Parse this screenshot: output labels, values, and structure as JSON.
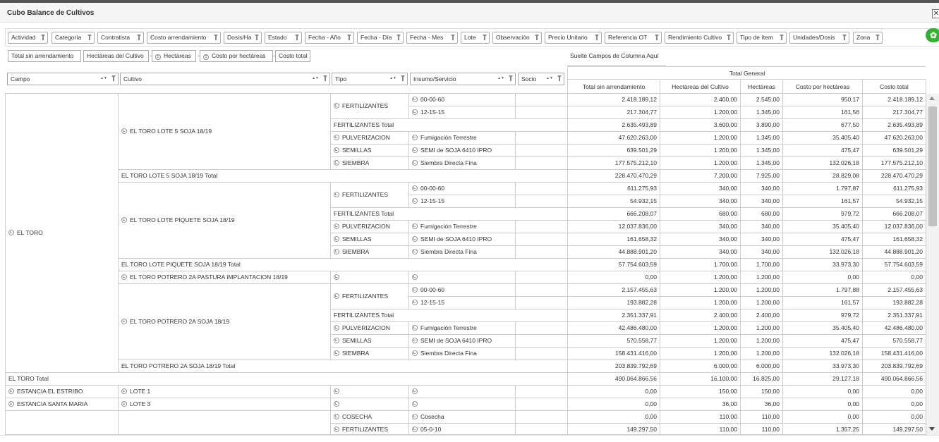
{
  "window": {
    "title": "Cubo Balance de Cultivos",
    "close_glyph": "✕"
  },
  "filter_fields": [
    "Actividad",
    "Categoría",
    "Contratista",
    "Costo arrendamiento",
    "Dosis/Ha",
    "Estado",
    "Fecha - Año",
    "Fecha - Día",
    "Fecha - Mes",
    "Lote",
    "Observación",
    "Precio Unitario",
    "Referencia OT",
    "Rendimiento Cultivo",
    "Tipo de ítem",
    "Unidades/Dosis",
    "Zona"
  ],
  "value_fields": [
    "Total sin arrendamiento",
    "Hectáreas del Cultivo",
    "Hectáreas",
    "Costo por hectáreas",
    "Costo total"
  ],
  "column_drop_hint": "Suelte Campos de Columna Aquí",
  "row_fields": [
    "Campo",
    "Cultivo",
    "Tipo",
    "Insumo/Servicio",
    "Socio"
  ],
  "total_general": "Total General",
  "measure_headers": [
    "Total sin arrendamiento",
    "Hectáreas del Cultivo",
    "Hectáreas",
    "Costo por hectáreas",
    "Costo total"
  ],
  "icons": {
    "filter": "filter-icon",
    "sort": "sort-icon",
    "expand": "expand-icon",
    "settings": "settings-icon"
  },
  "colors": {
    "accent_green": "#2db52d",
    "border": "#cccccc"
  },
  "campos": [
    {
      "label": "EL TORO",
      "expand": true
    },
    {
      "label": "EL TORO Total"
    },
    {
      "label": "ESTANCIA EL ESTRIBO",
      "expand": true
    },
    {
      "label": "ESTANCIA SANTA MARIA",
      "expand": true
    }
  ],
  "cultivos": [
    {
      "label": "EL TORO LOTE 5 SOJA 18/19",
      "expand": true
    },
    {
      "label": "EL TORO LOTE 5 SOJA 18/19 Total"
    },
    {
      "label": "EL TORO LOTE PIQUETE SOJA 18/19",
      "expand": true
    },
    {
      "label": "EL TORO LOTE PIQUETE SOJA 18/19 Total"
    },
    {
      "label": "EL TORO POTRERO 2A PASTURA IMPLANTACION 18/19",
      "expand": true
    },
    {
      "label": "EL TORO POTRERO 2A SOJA 18/19",
      "expand": true
    },
    {
      "label": "EL TORO POTRERO 2A SOJA 18/19 Total"
    },
    {
      "label": "LOTE 1",
      "expand": true
    },
    {
      "label": "LOTE 3",
      "expand": true
    }
  ],
  "tipos": [
    {
      "label": "FERTILIZANTES",
      "expand": true
    },
    {
      "label": "FERTILIZANTES Total"
    },
    {
      "label": "PULVERIZACION",
      "expand": true
    },
    {
      "label": "SEMILLAS",
      "expand": true
    },
    {
      "label": "SIEMBRA",
      "expand": true
    },
    {
      "label": "FERTILIZANTES",
      "expand": true
    },
    {
      "label": "FERTILIZANTES Total"
    },
    {
      "label": "PULVERIZACION",
      "expand": true
    },
    {
      "label": "SEMILLAS",
      "expand": true
    },
    {
      "label": "SIEMBRA",
      "expand": true
    },
    {
      "label": "",
      "expand": true
    },
    {
      "label": "FERTILIZANTES",
      "expand": true
    },
    {
      "label": "FERTILIZANTES Total"
    },
    {
      "label": "PULVERIZACION",
      "expand": true
    },
    {
      "label": "SEMILLAS",
      "expand": true
    },
    {
      "label": "SIEMBRA",
      "expand": true
    },
    {
      "label": "",
      "expand": true
    },
    {
      "label": "",
      "expand": true
    },
    {
      "label": "COSECHA",
      "expand": true
    },
    {
      "label": "FERTILIZANTES",
      "expand": true
    }
  ],
  "insumos": [
    {
      "label": "00-00-60",
      "expand": true
    },
    {
      "label": "12-15-15",
      "expand": true
    },
    {
      "label": "Fumigación Terrestre",
      "expand": true
    },
    {
      "label": "SEMI de SOJA 6410 IPRO",
      "expand": true
    },
    {
      "label": "Siembra Directa Fina",
      "expand": true
    },
    {
      "label": "00-00-60",
      "expand": true
    },
    {
      "label": "12-15-15",
      "expand": true
    },
    {
      "label": "Fumigación Terrestre",
      "expand": true
    },
    {
      "label": "SEMI de SOJA 6410 IPRO",
      "expand": true
    },
    {
      "label": "Siembra Directa Fina",
      "expand": true
    },
    {
      "label": "",
      "expand": true
    },
    {
      "label": "00-00-60",
      "expand": true
    },
    {
      "label": "12-15-15",
      "expand": true
    },
    {
      "label": "Fumigación Terrestre",
      "expand": true
    },
    {
      "label": "SEMI de SOJA 6410 IPRO",
      "expand": true
    },
    {
      "label": "Siembra Directa Fina",
      "expand": true
    },
    {
      "label": "",
      "expand": true
    },
    {
      "label": "",
      "expand": true
    },
    {
      "label": "Cosecha",
      "expand": true
    },
    {
      "label": "05-0-10",
      "expand": true
    }
  ],
  "value_rows": [
    [
      "2.418.189,12",
      "2.400,00",
      "2.545,00",
      "950,17",
      "2.418.189,12"
    ],
    [
      "217.304,77",
      "1.200,00",
      "1.345,00",
      "161,56",
      "217.304,77"
    ],
    [
      "2.635.493,89",
      "3.600,00",
      "3.890,00",
      "677,50",
      "2.635.493,89"
    ],
    [
      "47.620.263,00",
      "1.200,00",
      "1.345,00",
      "35.405,40",
      "47.620.263,00"
    ],
    [
      "639.501,29",
      "1.200,00",
      "1.345,00",
      "475,47",
      "639.501,29"
    ],
    [
      "177.575.212,10",
      "1.200,00",
      "1.345,00",
      "132.026,18",
      "177.575.212,10"
    ],
    [
      "228.470.470,29",
      "7.200,00",
      "7.925,00",
      "28.829,08",
      "228.470.470,29"
    ],
    [
      "611.275,93",
      "340,00",
      "340,00",
      "1.797,87",
      "611.275,93"
    ],
    [
      "54.932,15",
      "340,00",
      "340,00",
      "161,57",
      "54.932,15"
    ],
    [
      "666.208,07",
      "680,00",
      "680,00",
      "979,72",
      "666.208,07"
    ],
    [
      "12.037.836,00",
      "340,00",
      "340,00",
      "35.405,40",
      "12.037.836,00"
    ],
    [
      "161.658,32",
      "340,00",
      "340,00",
      "475,47",
      "161.658,32"
    ],
    [
      "44.888.901,20",
      "340,00",
      "340,00",
      "132.026,18",
      "44.888.901,20"
    ],
    [
      "57.754.603,59",
      "1.700,00",
      "1.700,00",
      "33.973,30",
      "57.754.603,59"
    ],
    [
      "0,00",
      "1.200,00",
      "1.200,00",
      "0,00",
      "0,00"
    ],
    [
      "2.157.455,63",
      "1.200,00",
      "1.200,00",
      "1.797,88",
      "2.157.455,63"
    ],
    [
      "193.882,28",
      "1.200,00",
      "1.200,00",
      "161,57",
      "193.882,28"
    ],
    [
      "2.351.337,91",
      "2.400,00",
      "2.400,00",
      "979,72",
      "2.351.337,91"
    ],
    [
      "42.486.480,00",
      "1.200,00",
      "1.200,00",
      "35.405,40",
      "42.486.480,00"
    ],
    [
      "570.558,77",
      "1.200,00",
      "1.200,00",
      "475,47",
      "570.558,77"
    ],
    [
      "158.431.416,00",
      "1.200,00",
      "1.200,00",
      "132.026,18",
      "158.431.416,00"
    ],
    [
      "203.839.792,69",
      "6.000,00",
      "6.000,00",
      "33.973,30",
      "203.839.792,69"
    ],
    [
      "490.064.866,56",
      "16.100,00",
      "16.825,00",
      "29.127,18",
      "490.064.866,56"
    ],
    [
      "0,00",
      "150,00",
      "150,00",
      "0,00",
      "0,00"
    ],
    [
      "0,00",
      "36,00",
      "36,00",
      "0,00",
      "0,00"
    ],
    [
      "0,00",
      "110,00",
      "110,00",
      "0,00",
      "0,00"
    ],
    [
      "149.297,50",
      "110,00",
      "110,00",
      "1.357,25",
      "149.297,50"
    ]
  ]
}
